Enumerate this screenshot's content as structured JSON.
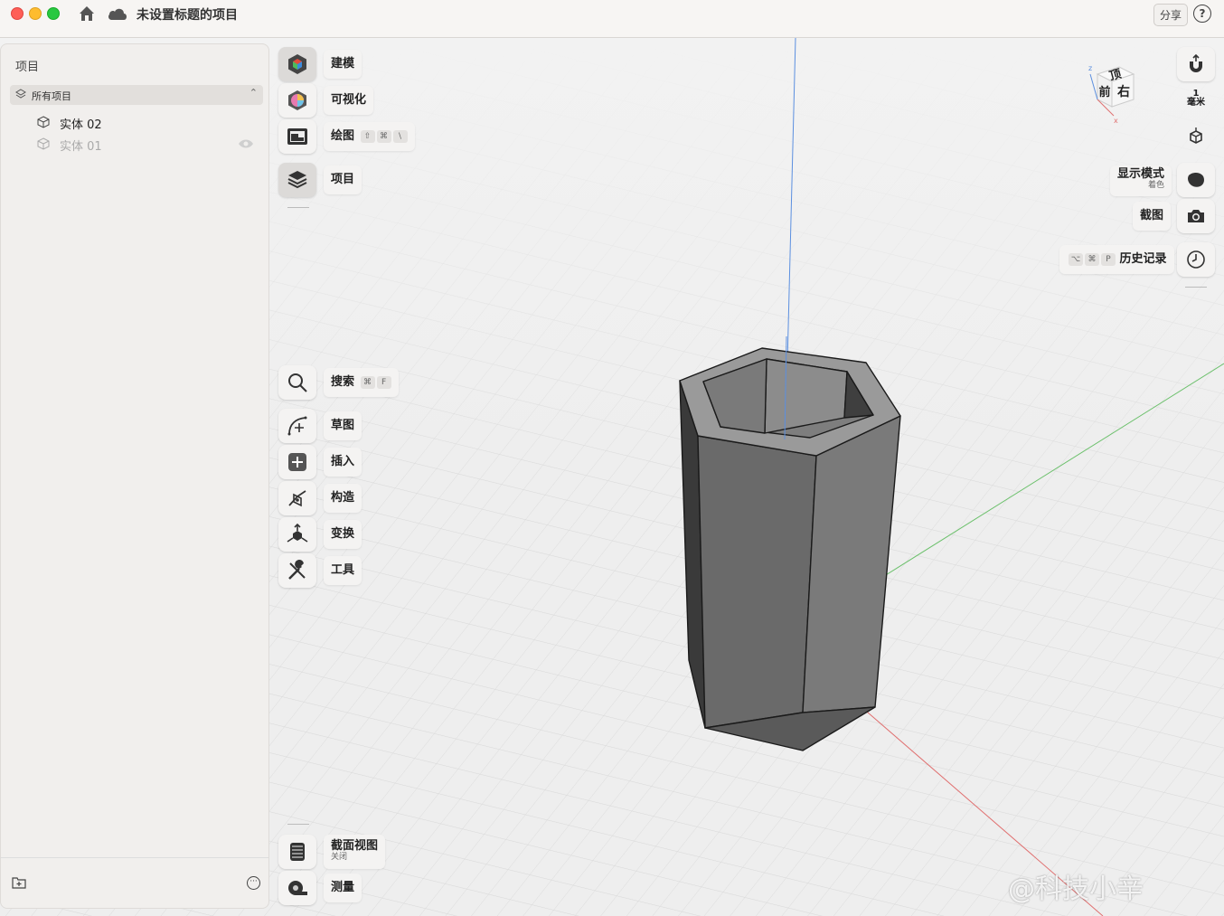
{
  "window": {
    "title": "未设置标题的项目",
    "share_label": "分享",
    "help_label": "?"
  },
  "sidebar": {
    "title": "项目",
    "scope": "所有项目",
    "items": [
      {
        "label": "实体  02",
        "visible": true
      },
      {
        "label": "实体  01",
        "visible": false
      }
    ]
  },
  "toolbar": {
    "modeling": "建模",
    "visualize": "可视化",
    "drawing": "绘图",
    "drawing_keys": [
      "⇧",
      "⌘",
      "\\"
    ],
    "project": "项目",
    "search": "搜索",
    "search_keys": [
      "⌘",
      "F"
    ],
    "sketch": "草图",
    "insert": "插入",
    "construct": "构造",
    "transform": "变换",
    "tools": "工具",
    "section_view": "截面视图",
    "section_view_state": "关闭",
    "measure": "测量"
  },
  "right_panel": {
    "unit_value": "1",
    "unit_name": "毫米",
    "display_mode": "显示模式",
    "display_mode_value": "着色",
    "screenshot": "截图",
    "history": "历史记录",
    "history_keys": [
      "⌥",
      "⌘",
      "P"
    ]
  },
  "view_cube": {
    "top": "顶",
    "front": "前",
    "right": "右"
  },
  "watermark": "@科技小辛",
  "colors": {
    "x_axis": "#e07070",
    "y_axis": "#6cc06c",
    "z_axis": "#5b8fe0",
    "model": "#6b6b6b"
  }
}
